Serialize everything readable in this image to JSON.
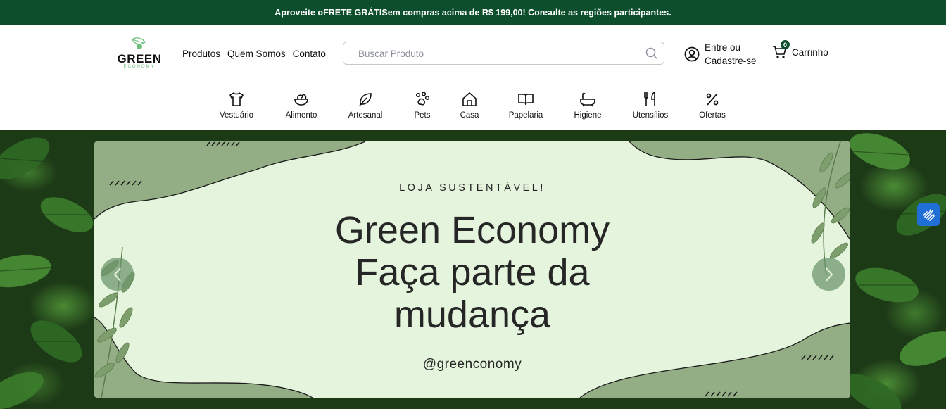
{
  "promo": {
    "prefix": "Aproveite o ",
    "bold": "FRETE GRÁTIS",
    "suffix": " em compras acima de R$ 199,00! Consulte as regiões participantes."
  },
  "logo": {
    "word": "GREEN",
    "sub": "ECONOMY"
  },
  "nav": {
    "produtos": "Produtos",
    "quem_somos": "Quem Somos",
    "contato": "Contato"
  },
  "search": {
    "placeholder": "Buscar Produto",
    "value": ""
  },
  "account": {
    "line1": "Entre ou",
    "line2": "Cadastre-se"
  },
  "cart": {
    "count": "0",
    "label": "Carrinho"
  },
  "categories": {
    "vestuario": "Vestuário",
    "alimento": "Alimento",
    "artesanal": "Artesanal",
    "pets": "Pets",
    "casa": "Casa",
    "papelaria": "Papelaria",
    "higiene": "Higiene",
    "utensilios": "Utensílios",
    "ofertas": "Ofertas"
  },
  "hero": {
    "kicker": "LOJA SUSTENTÁVEL!",
    "title_l1": "Green Economy",
    "title_l2": "Faça parte da",
    "title_l3": "mudança",
    "handle": "@greenconomy"
  },
  "colors": {
    "brand": "#0d4f2c",
    "banner_bg": "#e5f5dd",
    "banner_wave": "#93ad85",
    "accessibility": "#1f6fd6"
  }
}
